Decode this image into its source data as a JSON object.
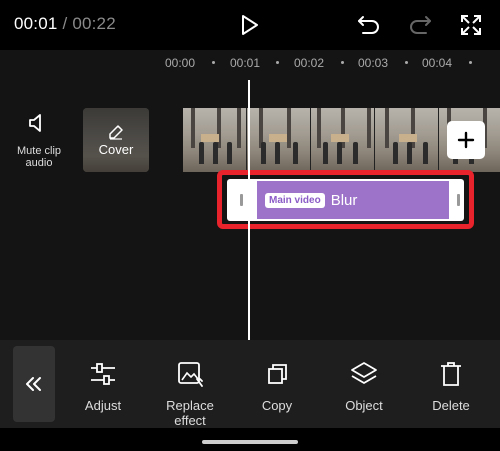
{
  "player": {
    "current_time": "00:01",
    "separator": " / ",
    "total_time": "00:22"
  },
  "topbar_icons": [
    "play-icon",
    "undo-icon",
    "redo-icon",
    "fullscreen-icon"
  ],
  "ruler": {
    "ticks": [
      "00:00",
      "00:01",
      "00:02",
      "00:03",
      "00:04"
    ]
  },
  "track": {
    "mute_label_line1": "Mute clip",
    "mute_label_line2": "audio",
    "cover_label": "Cover",
    "add_label": "+"
  },
  "effect_clip": {
    "badge": "Main video",
    "name": "Blur",
    "color": "#9d72c9",
    "highlight_color": "#e8232b"
  },
  "toolbar": {
    "back_label": "«",
    "items": [
      {
        "label_line1": "Adjust",
        "label_line2": "",
        "icon": "sliders-icon"
      },
      {
        "label_line1": "Replace",
        "label_line2": "effect",
        "icon": "replace-effect-icon"
      },
      {
        "label_line1": "Copy",
        "label_line2": "",
        "icon": "copy-icon"
      },
      {
        "label_line1": "Object",
        "label_line2": "",
        "icon": "layers-icon"
      },
      {
        "label_line1": "Delete",
        "label_line2": "",
        "icon": "trash-icon"
      }
    ]
  }
}
